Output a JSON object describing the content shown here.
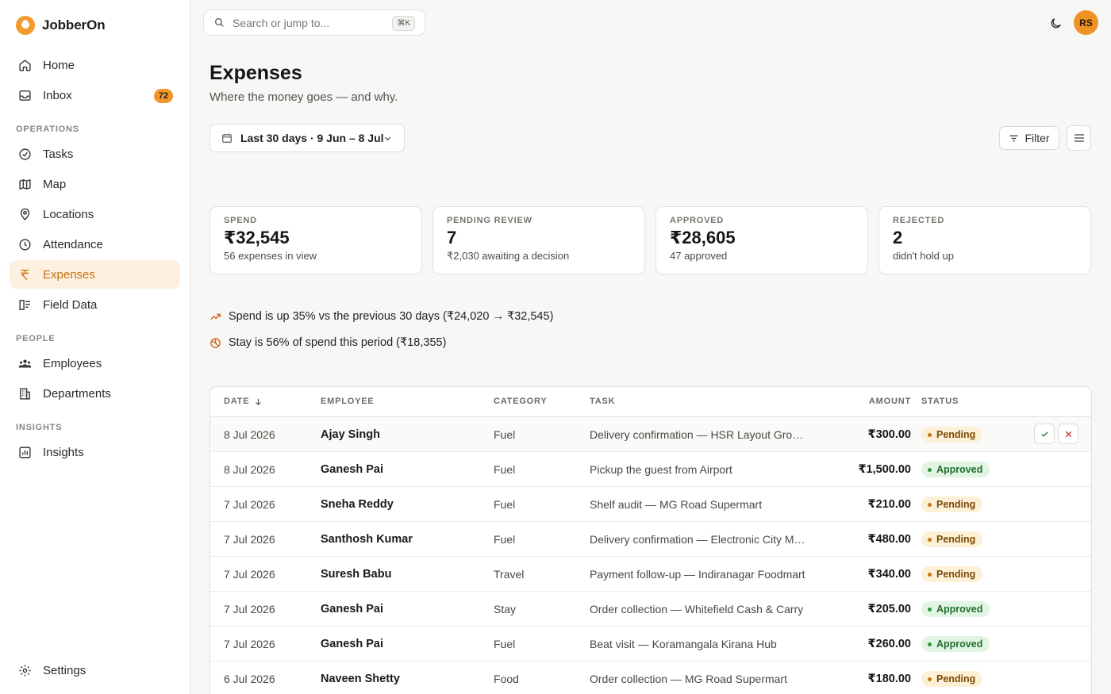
{
  "brand": {
    "name": "JobberOn"
  },
  "sidebar": {
    "top_items": [
      {
        "label": "Home",
        "icon": "home-icon"
      },
      {
        "label": "Inbox",
        "icon": "inbox-icon",
        "badge": "72"
      }
    ],
    "sections": [
      {
        "label": "OPERATIONS",
        "items": [
          {
            "label": "Tasks",
            "icon": "tasks-icon"
          },
          {
            "label": "Map",
            "icon": "map-icon"
          },
          {
            "label": "Locations",
            "icon": "location-pin-icon"
          },
          {
            "label": "Attendance",
            "icon": "clock-icon"
          },
          {
            "label": "Expenses",
            "icon": "rupee-icon",
            "active": true
          },
          {
            "label": "Field Data",
            "icon": "field-data-icon"
          }
        ]
      },
      {
        "label": "PEOPLE",
        "items": [
          {
            "label": "Employees",
            "icon": "users-icon"
          },
          {
            "label": "Departments",
            "icon": "building-icon"
          }
        ]
      },
      {
        "label": "INSIGHTS",
        "items": [
          {
            "label": "Insights",
            "icon": "chart-icon"
          }
        ]
      }
    ],
    "settings_label": "Settings"
  },
  "topbar": {
    "search_placeholder": "Search or jump to...",
    "search_shortcut": "⌘K",
    "avatar_initials": "RS"
  },
  "page": {
    "title": "Expenses",
    "subtitle": "Where the money goes — and why.",
    "date_range": "Last 30 days · 9 Jun – 8 Jul",
    "filter_label": "Filter"
  },
  "stats": [
    {
      "label": "SPEND",
      "value": "₹32,545",
      "sub": "56 expenses in view"
    },
    {
      "label": "PENDING REVIEW",
      "value": "7",
      "sub": "₹2,030 awaiting a decision"
    },
    {
      "label": "APPROVED",
      "value": "₹28,605",
      "sub": "47 approved"
    },
    {
      "label": "REJECTED",
      "value": "2",
      "sub": "didn't hold up"
    }
  ],
  "insights": [
    {
      "text": "Spend is up 35% vs the previous 30 days (₹24,020 → ₹32,545)",
      "icon": "trending-up-icon"
    },
    {
      "text": "Stay is 56% of spend this period (₹18,355)",
      "icon": "pie-chart-icon"
    }
  ],
  "table": {
    "columns": [
      "DATE",
      "EMPLOYEE",
      "CATEGORY",
      "TASK",
      "AMOUNT",
      "STATUS"
    ],
    "rows": [
      {
        "date": "8 Jul 2026",
        "employee": "Ajay Singh",
        "category": "Fuel",
        "task": "Delivery confirmation — HSR Layout Grocery",
        "amount": "₹300.00",
        "status": "Pending"
      },
      {
        "date": "8 Jul 2026",
        "employee": "Ganesh Pai",
        "category": "Fuel",
        "task": "Pickup the guest from Airport",
        "amount": "₹1,500.00",
        "status": "Approved"
      },
      {
        "date": "7 Jul 2026",
        "employee": "Sneha Reddy",
        "category": "Fuel",
        "task": "Shelf audit — MG Road Supermart",
        "amount": "₹210.00",
        "status": "Pending"
      },
      {
        "date": "7 Jul 2026",
        "employee": "Santhosh Kumar",
        "category": "Fuel",
        "task": "Delivery confirmation — Electronic City Mart",
        "amount": "₹480.00",
        "status": "Pending"
      },
      {
        "date": "7 Jul 2026",
        "employee": "Suresh Babu",
        "category": "Travel",
        "task": "Payment follow-up — Indiranagar Foodmart",
        "amount": "₹340.00",
        "status": "Pending"
      },
      {
        "date": "7 Jul 2026",
        "employee": "Ganesh Pai",
        "category": "Stay",
        "task": "Order collection — Whitefield Cash & Carry",
        "amount": "₹205.00",
        "status": "Approved"
      },
      {
        "date": "7 Jul 2026",
        "employee": "Ganesh Pai",
        "category": "Fuel",
        "task": "Beat visit — Koramangala Kirana Hub",
        "amount": "₹260.00",
        "status": "Approved"
      },
      {
        "date": "6 Jul 2026",
        "employee": "Naveen Shetty",
        "category": "Food",
        "task": "Order collection — MG Road Supermart",
        "amount": "₹180.00",
        "status": "Pending"
      }
    ]
  }
}
